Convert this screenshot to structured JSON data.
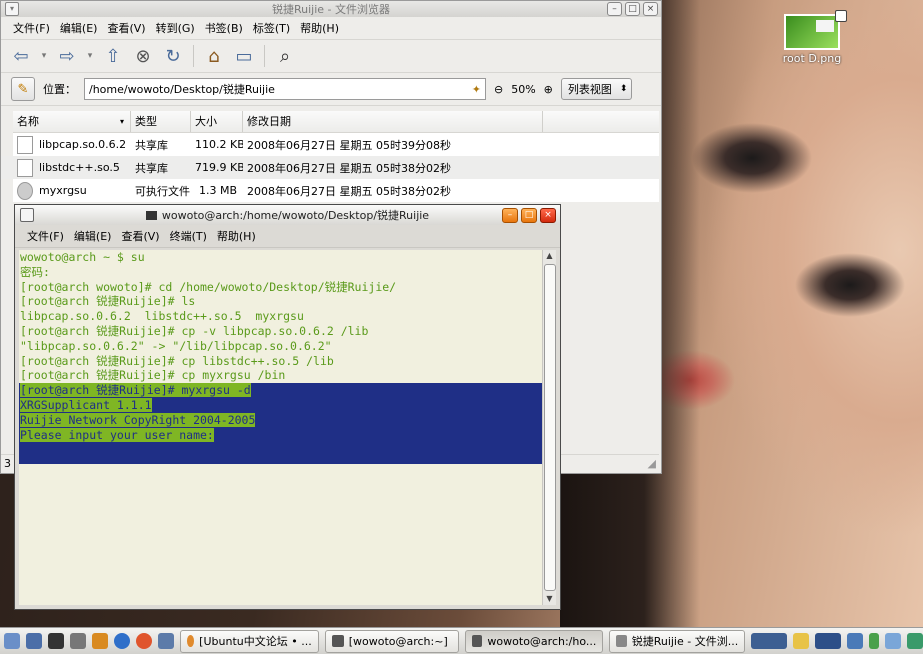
{
  "desktop": {
    "icon_label": "root D.png"
  },
  "file_manager": {
    "title": "锐捷Ruijie - 文件浏览器",
    "menu": [
      "文件(F)",
      "编辑(E)",
      "查看(V)",
      "转到(G)",
      "书签(B)",
      "标签(T)",
      "帮助(H)"
    ],
    "location_label": "位置：",
    "location_value": "/home/wowoto/Desktop/锐捷Ruijie",
    "zoom": "50%",
    "view_mode": "列表视图",
    "columns": [
      "名称",
      "类型",
      "大小",
      "修改日期"
    ],
    "files": [
      {
        "name": "libpcap.so.0.6.2",
        "type": "共享库",
        "size": "110.2 KB",
        "date": "2008年06月27日 星期五 05时39分08秒"
      },
      {
        "name": "libstdc++.so.5",
        "type": "共享库",
        "size": "719.9 KB",
        "date": "2008年06月27日 星期五 05时38分02秒"
      },
      {
        "name": "myxrgsu",
        "type": "可执行文件",
        "size": "1.3 MB",
        "date": "2008年06月27日 星期五 05时38分02秒"
      }
    ],
    "status_text": "3"
  },
  "terminal": {
    "title": "wowoto@arch:/home/wowoto/Desktop/锐捷Ruijie",
    "menu": [
      "文件(F)",
      "编辑(E)",
      "查看(V)",
      "终端(T)",
      "帮助(H)"
    ],
    "lines": [
      "wowoto@arch ~ $ su",
      "密码:",
      "[root@arch wowoto]# cd /home/wowoto/Desktop/锐捷Ruijie/",
      "[root@arch 锐捷Ruijie]# ls",
      "libpcap.so.0.6.2  libstdc++.so.5  myxrgsu",
      "[root@arch 锐捷Ruijie]# cp -v libpcap.so.0.6.2 /lib",
      "\"libpcap.so.0.6.2\" -> \"/lib/libpcap.so.0.6.2\"",
      "[root@arch 锐捷Ruijie]# cp libstdc++.so.5 /lib",
      "[root@arch 锐捷Ruijie]# cp myxrgsu /bin"
    ],
    "selected_lines": [
      "[root@arch 锐捷Ruijie]# myxrgsu -d",
      "XRGSupplicant 1.1.1",
      "Ruijie Network CopyRight 2004-2005",
      "Please input your user name:"
    ]
  },
  "taskbar": {
    "tasks": [
      {
        "label": "[Ubuntu中文论坛 • ..."
      },
      {
        "label": "[wowoto@arch:~]"
      },
      {
        "label": "wowoto@arch:/ho..."
      },
      {
        "label": "锐捷Ruijie - 文件浏..."
      }
    ]
  }
}
